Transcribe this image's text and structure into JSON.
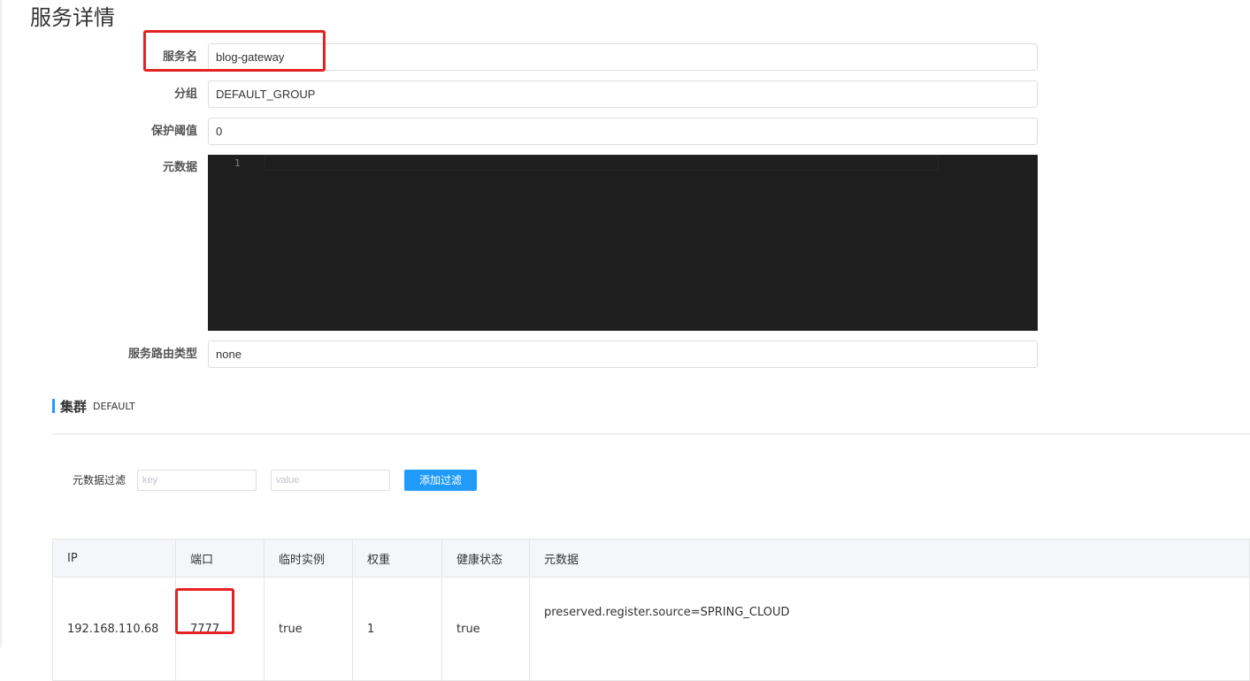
{
  "page": {
    "title": "服务详情"
  },
  "form": {
    "service_name": {
      "label": "服务名",
      "value": "blog-gateway"
    },
    "group": {
      "label": "分组",
      "value": "DEFAULT_GROUP"
    },
    "protect_threshold": {
      "label": "保护阈值",
      "value": "0"
    },
    "metadata": {
      "label": "元数据",
      "line_number": "1"
    },
    "selector_type": {
      "label": "服务路由类型",
      "value": "none"
    }
  },
  "cluster": {
    "title": "集群",
    "name": "DEFAULT",
    "filter": {
      "label": "元数据过滤",
      "key_placeholder": "key",
      "value_placeholder": "value",
      "add_button": "添加过滤"
    },
    "table": {
      "headers": [
        "IP",
        "端口",
        "临时实例",
        "权重",
        "健康状态",
        "元数据"
      ],
      "rows": [
        [
          "192.168.110.68",
          "7777",
          "true",
          "1",
          "true",
          "preserved.register.source=SPRING_CLOUD"
        ]
      ]
    }
  },
  "colors": {
    "accent": "#209bfa",
    "highlight": "#e52222",
    "editor_bg": "#1e1e1e"
  }
}
